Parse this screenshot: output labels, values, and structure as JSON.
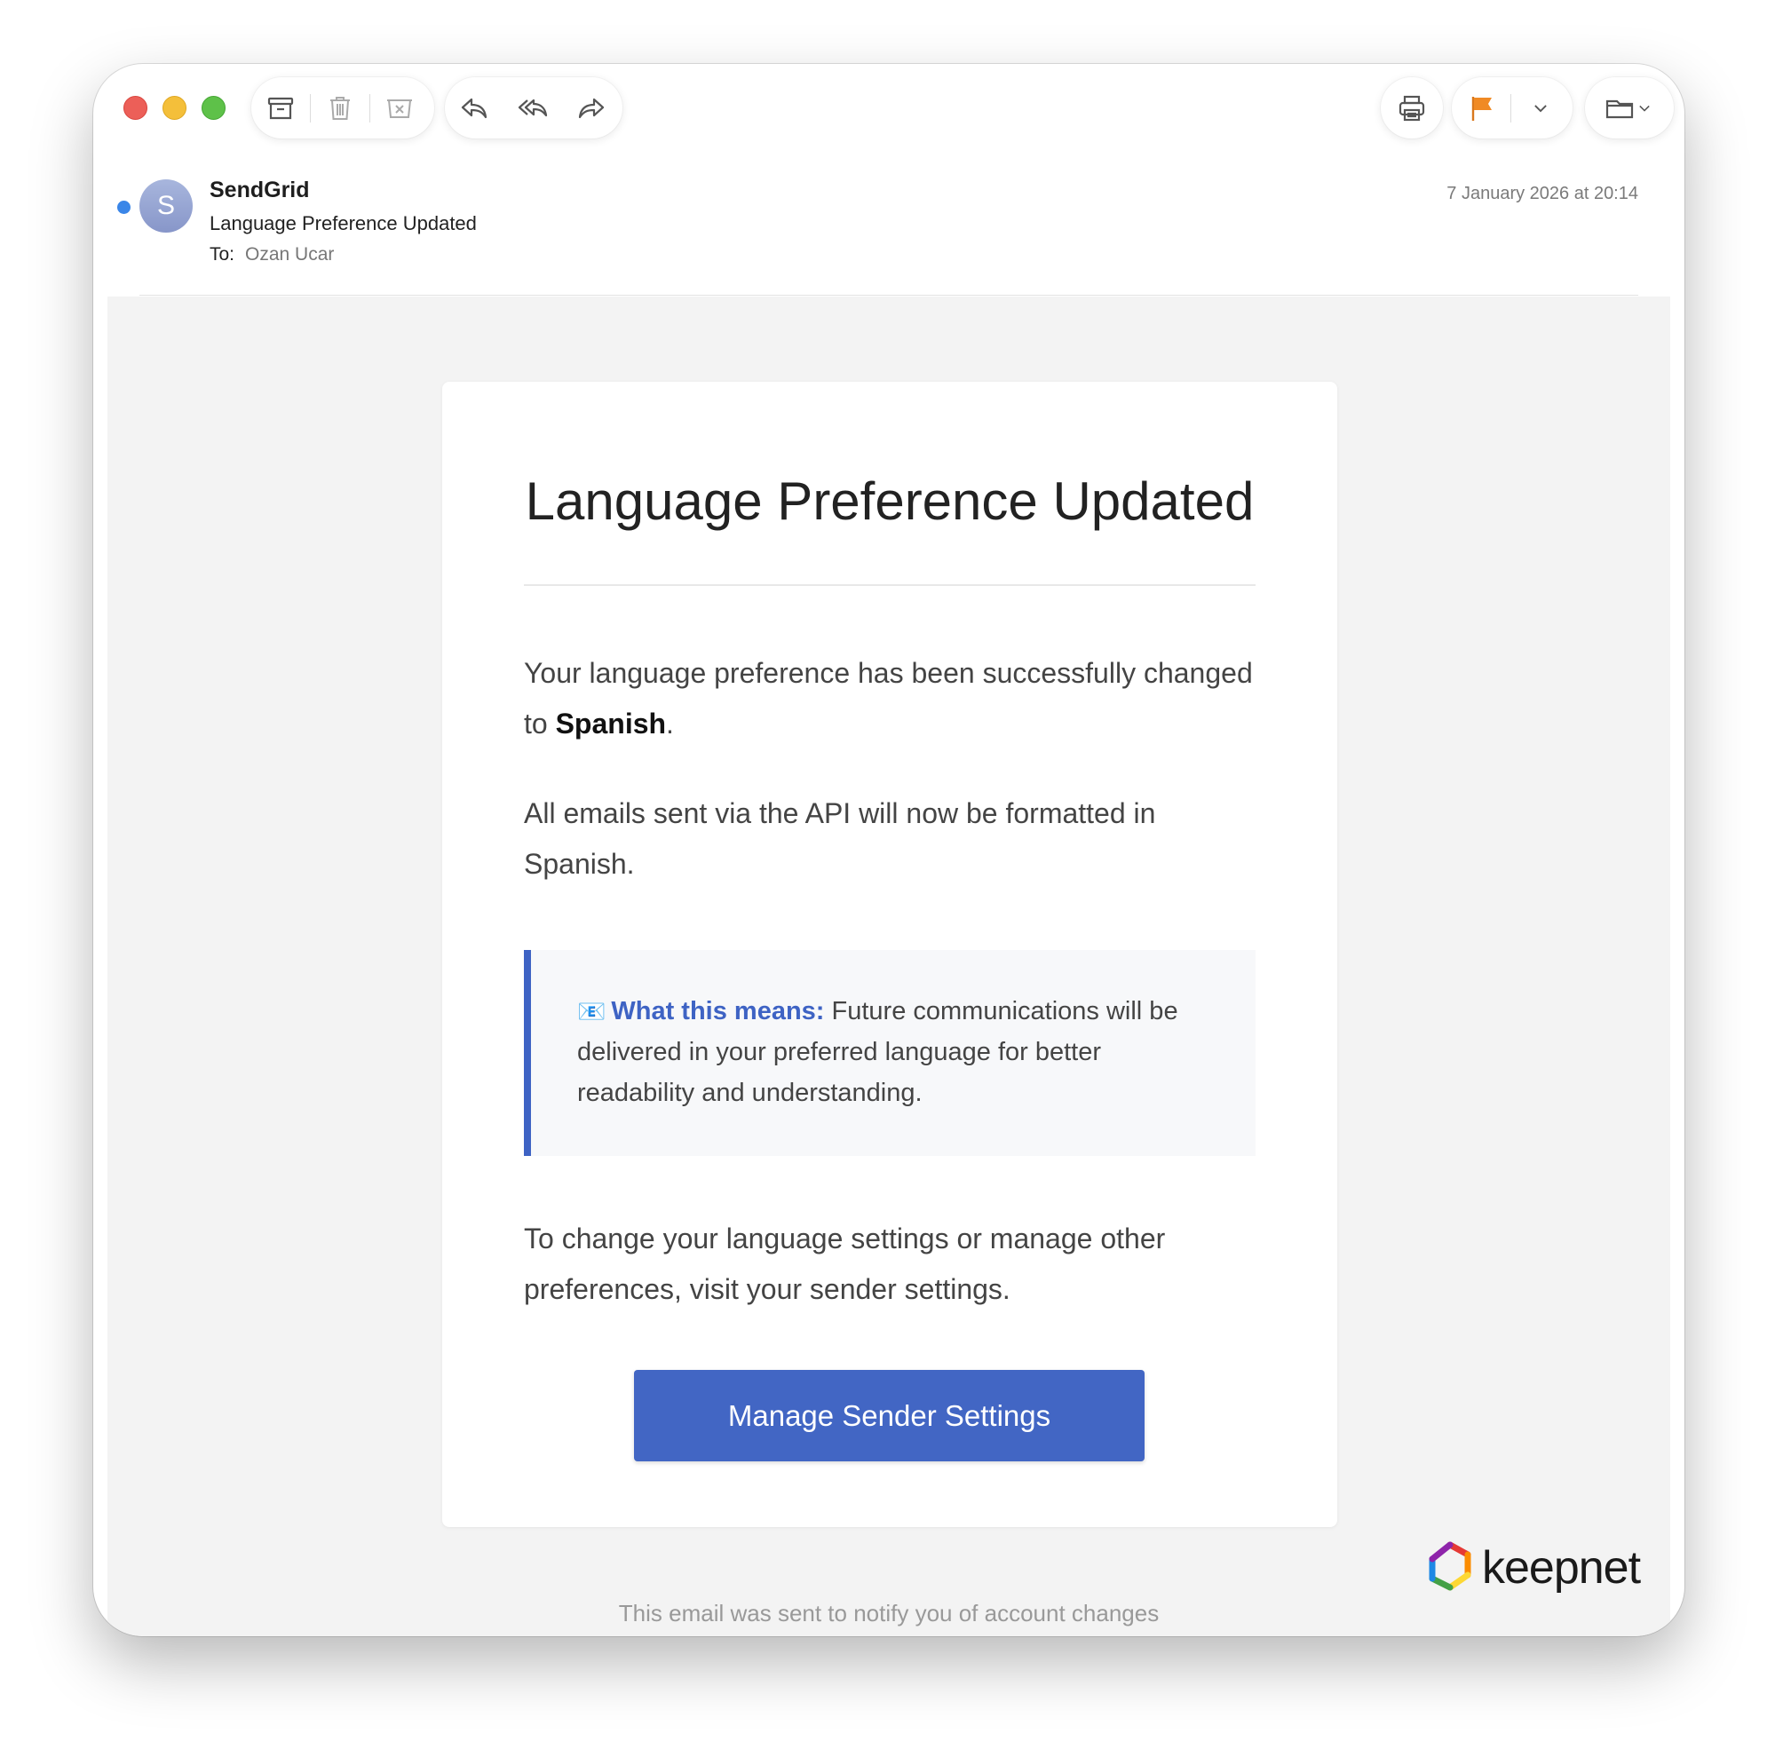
{
  "toolbar": {
    "icons": [
      "archive-icon",
      "trash-icon",
      "junk-icon",
      "reply-icon",
      "reply-all-icon",
      "forward-icon",
      "print-icon",
      "flag-icon",
      "chevron-down-icon",
      "folder-icon"
    ]
  },
  "header": {
    "avatar_initial": "S",
    "sender": "SendGrid",
    "subject": "Language Preference Updated",
    "to_label": "To:",
    "to_name": "Ozan Ucar",
    "date": "7 January 2026 at 20:14"
  },
  "email": {
    "title": "Language Preference Updated",
    "p1_text": "Your language preference has been successfully changed to ",
    "p1_bold": "Spanish",
    "p1_end": ".",
    "p2": "All emails sent via the API will now be formatted in Spanish.",
    "callout_emoji": "📧",
    "callout_lead": "What this means:",
    "callout_text": " Future communications will be delivered in your preferred language for better readability and understanding.",
    "p3": "To change your language settings or manage other preferences, visit your sender settings.",
    "cta_label": "Manage Sender Settings",
    "footer": "This email was sent to notify you of account changes"
  },
  "brand": {
    "logo_text": "keepnet"
  },
  "colors": {
    "accent": "#4266c4",
    "unread": "#3a86e8",
    "flag": "#f08a24"
  }
}
